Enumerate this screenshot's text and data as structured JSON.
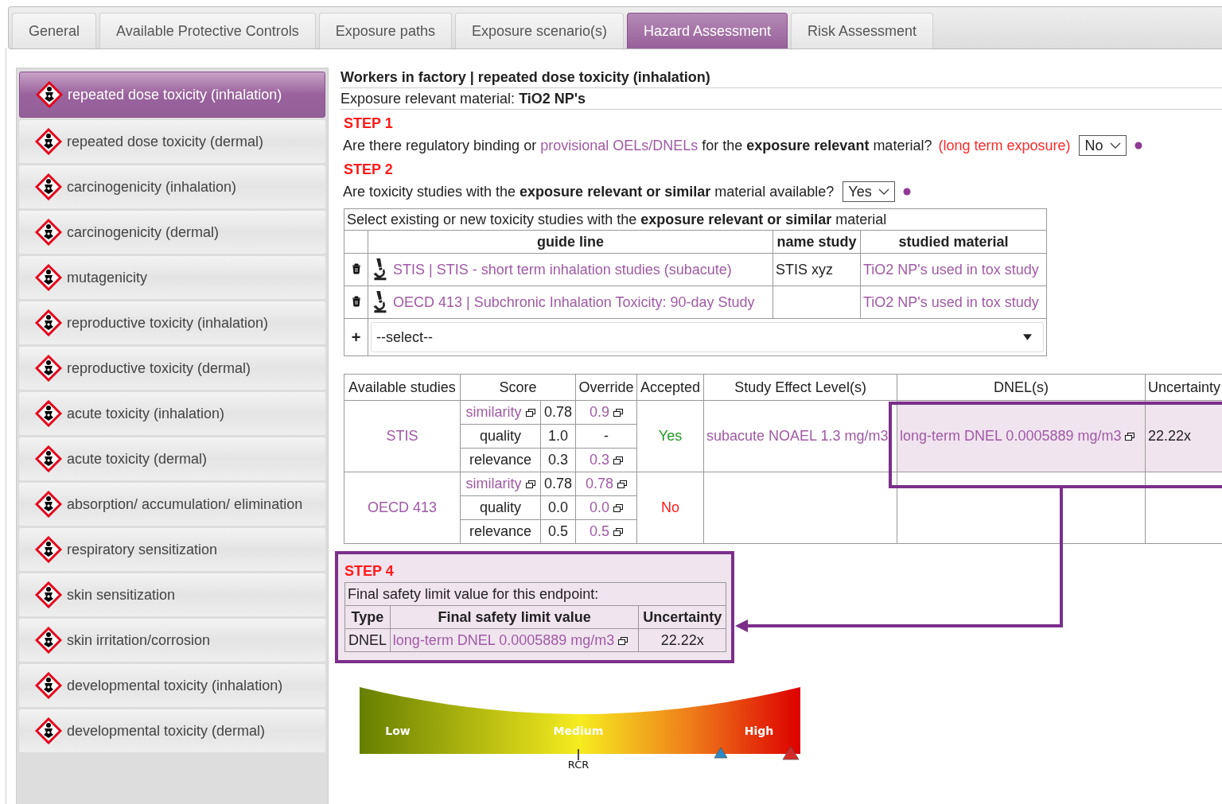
{
  "tabs": [
    {
      "label": "General",
      "selected": false
    },
    {
      "label": "Available Protective Controls",
      "selected": false
    },
    {
      "label": "Exposure paths",
      "selected": false
    },
    {
      "label": "Exposure scenario(s)",
      "selected": false
    },
    {
      "label": "Hazard Assessment",
      "selected": true
    },
    {
      "label": "Risk Assessment",
      "selected": false
    }
  ],
  "sidebar": {
    "items": [
      {
        "label": "repeated dose toxicity (inhalation)",
        "selected": true
      },
      {
        "label": "repeated dose toxicity (dermal)",
        "selected": false
      },
      {
        "label": "carcinogenicity (inhalation)",
        "selected": false
      },
      {
        "label": "carcinogenicity (dermal)",
        "selected": false
      },
      {
        "label": "mutagenicity",
        "selected": false
      },
      {
        "label": "reproductive toxicity (inhalation)",
        "selected": false
      },
      {
        "label": "reproductive toxicity (dermal)",
        "selected": false
      },
      {
        "label": "acute toxicity (inhalation)",
        "selected": false
      },
      {
        "label": "acute toxicity (dermal)",
        "selected": false
      },
      {
        "label": "absorption/ accumulation/ elimination",
        "selected": false
      },
      {
        "label": "respiratory sensitization",
        "selected": false
      },
      {
        "label": "skin sensitization",
        "selected": false
      },
      {
        "label": "skin irritation/corrosion",
        "selected": false
      },
      {
        "label": "developmental toxicity (inhalation)",
        "selected": false
      },
      {
        "label": "developmental toxicity (dermal)",
        "selected": false
      }
    ]
  },
  "header": {
    "title": "Workers in factory | repeated dose toxicity (inhalation)",
    "material_label": "Exposure relevant material:",
    "material": "TiO2 NP's"
  },
  "step1": {
    "heading": "STEP 1",
    "question_start": "Are there regulatory binding or",
    "link": "provisional OELs/DNELs",
    "question_end": "for the **exposure relevant** material?",
    "note": "(long term exposure)",
    "answer": "No"
  },
  "step2": {
    "heading": "STEP 2",
    "question": "Are toxicity studies with the **exposure relevant or similar** material available?",
    "answer": "Yes",
    "studies_table": {
      "caption": "Select existing or new toxicity studies with the **exposure relevant or similar** material",
      "columns": [
        "guide line",
        "name study",
        "studied material"
      ],
      "rows": [
        {
          "guide_line": "STIS | STIS - short term inhalation studies (subacute)",
          "name_study": "STIS xyz",
          "material": "TiO2 NP's used in tox study"
        },
        {
          "guide_line": "OECD 413 | Subchronic Inhalation Toxicity: 90-day Study",
          "material": "TiO2 NP's used in tox study"
        }
      ],
      "add_symbol": "+",
      "add_placeholder": "--select--"
    }
  },
  "results_table": {
    "columns": [
      "Available studies",
      "Score",
      "Override",
      "Accepted",
      "Study Effect Level(s)",
      "DNEL(s)",
      "Uncertainty"
    ],
    "studies": [
      {
        "name": "STIS",
        "scores": [
          {
            "criterion": "similarity",
            "linked": true,
            "score": "0.78",
            "override": "0.9",
            "override_linked": true
          },
          {
            "criterion": "quality",
            "linked": false,
            "score": "1.0",
            "override": "-",
            "override_linked": false
          },
          {
            "criterion": "relevance",
            "linked": false,
            "score": "0.3",
            "override": "0.3",
            "override_linked": true
          }
        ],
        "accepted": true,
        "accepted_label": "Yes",
        "effect_level": "subacute NOAEL 1.3 mg/m3",
        "dnel": "long-term DNEL 0.0005889 mg/m3",
        "uncertainty": "22.22x"
      },
      {
        "name": "OECD 413",
        "scores": [
          {
            "criterion": "similarity",
            "linked": true,
            "score": "0.78",
            "override": "0.78",
            "override_linked": true
          },
          {
            "criterion": "quality",
            "linked": false,
            "score": "0.0",
            "override": "0.0",
            "override_linked": true
          },
          {
            "criterion": "relevance",
            "linked": false,
            "score": "0.5",
            "override": "0.5",
            "override_linked": true
          }
        ],
        "accepted": false,
        "accepted_label": "No"
      }
    ]
  },
  "step4": {
    "heading": "STEP 4",
    "caption": "Final safety limit value for this endpoint:",
    "columns": [
      "Type",
      "Final safety limit value",
      "Uncertainty"
    ],
    "row": {
      "type": "DNEL",
      "value": "long-term DNEL 0.0005889 mg/m3",
      "uncertainty": "22.22x"
    }
  },
  "gauge": {
    "labels": [
      "Low",
      "Medium",
      "High"
    ],
    "marker": "RCR"
  }
}
